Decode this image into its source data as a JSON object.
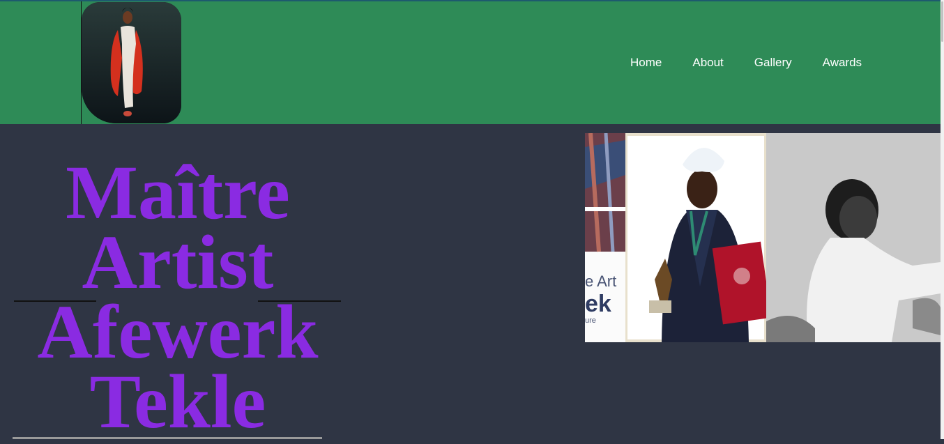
{
  "nav": {
    "items": [
      {
        "label": "Home"
      },
      {
        "label": "About"
      },
      {
        "label": "Gallery"
      },
      {
        "label": "Awards"
      }
    ]
  },
  "hero": {
    "title_lines": [
      "Maître",
      "Artist",
      "Afewerk",
      "Tekle"
    ],
    "banner_text": {
      "line1": "e Art",
      "line2": "ek",
      "line3": "ure"
    }
  },
  "colors": {
    "header_bg": "#2e8b57",
    "page_bg": "#2f3544",
    "title": "#8a2be2",
    "nav_text": "#ffffff"
  }
}
